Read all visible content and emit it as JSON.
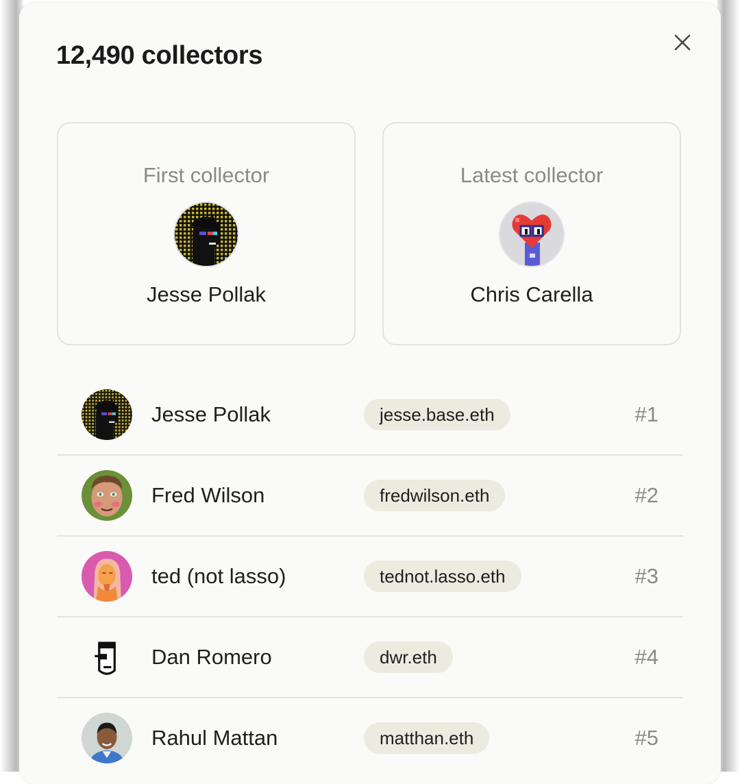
{
  "header": {
    "title": "12,490 collectors"
  },
  "first": {
    "label": "First collector",
    "name": "Jesse Pollak",
    "avatar_icon": "pixel-punk-avatar"
  },
  "latest": {
    "label": "Latest collector",
    "name": "Chris Carella",
    "avatar_icon": "pixel-heart-avatar"
  },
  "collectors": [
    {
      "name": "Jesse Pollak",
      "ens": "jesse.base.eth",
      "rank": "#1",
      "avatar_icon": "pixel-punk-avatar"
    },
    {
      "name": "Fred Wilson",
      "ens": "fredwilson.eth",
      "rank": "#2",
      "avatar_icon": "cartoon-face-avatar"
    },
    {
      "name": "ted (not lasso)",
      "ens": "tednot.lasso.eth",
      "rank": "#3",
      "avatar_icon": "illustrated-portrait-avatar"
    },
    {
      "name": "Dan Romero",
      "ens": "dwr.eth",
      "rank": "#4",
      "avatar_icon": "line-art-face-avatar"
    },
    {
      "name": "Rahul Mattan",
      "ens": "matthan.eth",
      "rank": "#5",
      "avatar_icon": "photo-portrait-avatar"
    }
  ],
  "colors": {
    "ens_pill": "#ecebe0",
    "muted_text": "#8a8a86",
    "divider": "#e3e3df"
  }
}
